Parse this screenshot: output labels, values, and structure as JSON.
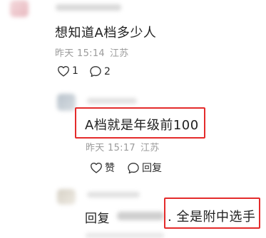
{
  "comments": [
    {
      "text": "想知道A档多少人",
      "time": "昨天 15:14",
      "location": "江苏",
      "likes": "1",
      "replies": "2"
    }
  ],
  "replies": [
    {
      "text": "A档就是年级前100",
      "time": "昨天 15:17",
      "location": "江苏",
      "like_label": "赞",
      "reply_label": "回复"
    },
    {
      "reply_prefix": "回复",
      "text": ". 全是附中选手"
    }
  ],
  "colors": {
    "highlight": "#e42b2b",
    "meta": "#9b9b9b"
  },
  "icons": [
    "like-icon",
    "comment-icon"
  ]
}
